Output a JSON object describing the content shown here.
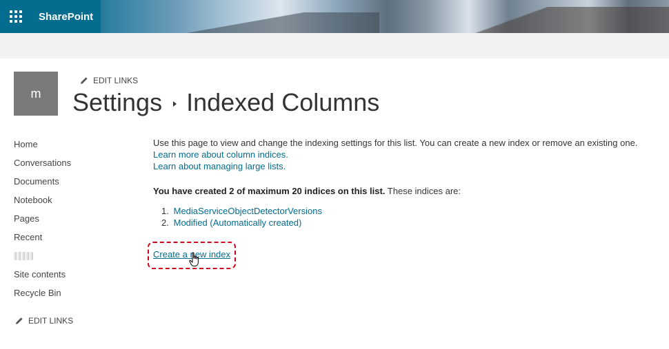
{
  "header": {
    "app_name": "SharePoint",
    "waffle_icon": "app-launcher-icon"
  },
  "site": {
    "logo_letter": "m",
    "edit_links_top": "EDIT LINKS",
    "breadcrumb": [
      "Settings",
      "Indexed Columns"
    ]
  },
  "nav": {
    "items": [
      "Home",
      "Conversations",
      "Documents",
      "Notebook",
      "Pages",
      "Recent",
      "",
      "Site contents",
      "Recycle Bin"
    ],
    "edit_links_bottom": "EDIT LINKS"
  },
  "main": {
    "intro": "Use this page to view and change the indexing settings for this list. You can create a new index or remove an existing one.",
    "learn_column_indices": "Learn more about column indices.",
    "learn_large_lists": "Learn about managing large lists.",
    "summary_bold": "You have created 2 of maximum 20 indices on this list.",
    "summary_rest": " These indices are:",
    "indices": [
      {
        "num": "1.",
        "label": "MediaServiceObjectDetectorVersions"
      },
      {
        "num": "2.",
        "label": "Modified (Automatically created)"
      }
    ],
    "create_link": "Create a new index"
  },
  "colors": {
    "brand": "#036c8f",
    "link": "#036c8f",
    "highlight": "#d0021b"
  }
}
